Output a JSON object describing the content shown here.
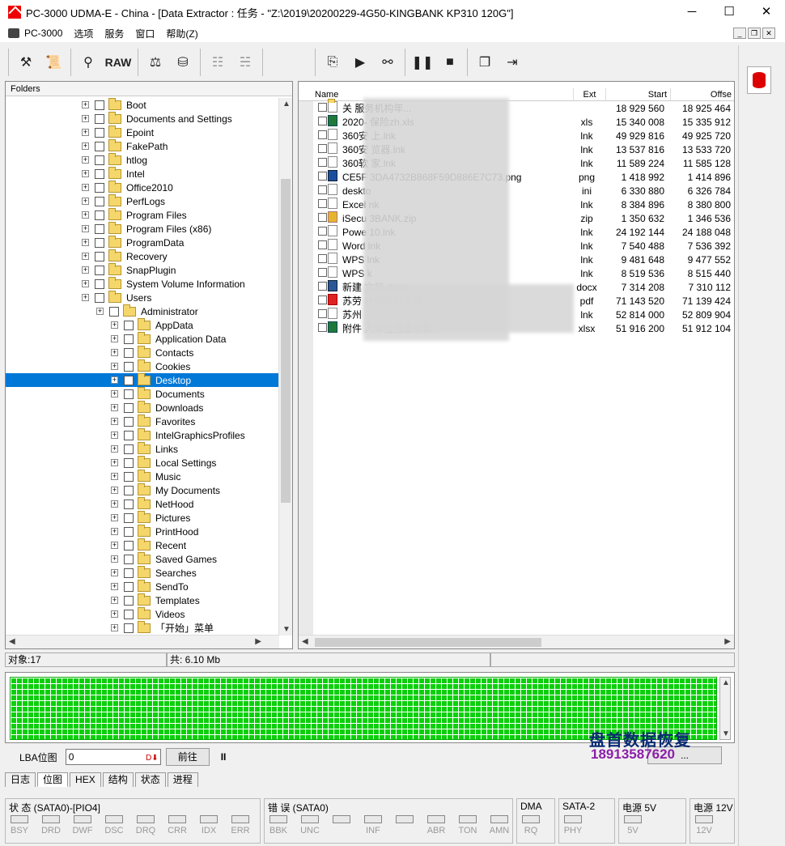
{
  "window": {
    "title": "PC-3000 UDMA-E - China - [Data Extractor : 任务 - \"Z:\\2019\\20200229-4G50-KINGBANK KP310 120G\"]",
    "minimize": "─",
    "maximize": "☐",
    "close": "✕"
  },
  "menu": [
    "PC-3000",
    "选项",
    "服务",
    "窗口",
    "帮助(Z)"
  ],
  "toolbar": {
    "raw": "RAW"
  },
  "folders": {
    "header": "Folders",
    "items": [
      {
        "label": "Boot",
        "level": 0
      },
      {
        "label": "Documents and Settings",
        "level": 0
      },
      {
        "label": "Epoint",
        "level": 0
      },
      {
        "label": "FakePath",
        "level": 0
      },
      {
        "label": "htlog",
        "level": 0
      },
      {
        "label": "Intel",
        "level": 0
      },
      {
        "label": "Office2010",
        "level": 0
      },
      {
        "label": "PerfLogs",
        "level": 0
      },
      {
        "label": "Program Files",
        "level": 0
      },
      {
        "label": "Program Files (x86)",
        "level": 0
      },
      {
        "label": "ProgramData",
        "level": 0
      },
      {
        "label": "Recovery",
        "level": 0
      },
      {
        "label": "SnapPlugin",
        "level": 0
      },
      {
        "label": "System Volume Information",
        "level": 0
      },
      {
        "label": "Users",
        "level": 0
      },
      {
        "label": "Administrator",
        "level": 1
      },
      {
        "label": "AppData",
        "level": 2
      },
      {
        "label": "Application Data",
        "level": 2
      },
      {
        "label": "Contacts",
        "level": 2
      },
      {
        "label": "Cookies",
        "level": 2
      },
      {
        "label": "Desktop",
        "level": 2,
        "selected": true
      },
      {
        "label": "Documents",
        "level": 2
      },
      {
        "label": "Downloads",
        "level": 2
      },
      {
        "label": "Favorites",
        "level": 2
      },
      {
        "label": "IntelGraphicsProfiles",
        "level": 2
      },
      {
        "label": "Links",
        "level": 2
      },
      {
        "label": "Local Settings",
        "level": 2
      },
      {
        "label": "Music",
        "level": 2
      },
      {
        "label": "My Documents",
        "level": 2
      },
      {
        "label": "NetHood",
        "level": 2
      },
      {
        "label": "Pictures",
        "level": 2
      },
      {
        "label": "PrintHood",
        "level": 2
      },
      {
        "label": "Recent",
        "level": 2
      },
      {
        "label": "Saved Games",
        "level": 2
      },
      {
        "label": "Searches",
        "level": 2
      },
      {
        "label": "SendTo",
        "level": 2
      },
      {
        "label": "Templates",
        "level": 2
      },
      {
        "label": "Videos",
        "level": 2
      },
      {
        "label": "「开始」菜单",
        "level": 2
      }
    ]
  },
  "files": {
    "columns": [
      "Name",
      "Ext",
      "Start",
      "Offse"
    ],
    "rows": [
      {
        "name": "关                              服务机构年...",
        "ext": "",
        "start": "18 929 560",
        "off": "18 925 464",
        "icon": "folder"
      },
      {
        "name": "2020-         保险zh.xls",
        "ext": "xls",
        "start": "15 340 008",
        "off": "15 335 912",
        "icon": "xls"
      },
      {
        "name": "360安       上.lnk",
        "ext": "lnk",
        "start": "49 929 816",
        "off": "49 925 720",
        "icon": "lnk"
      },
      {
        "name": "360安       览器.lnk",
        "ext": "lnk",
        "start": "13 537 816",
        "off": "13 533 720",
        "icon": "lnk"
      },
      {
        "name": "360软       家.lnk",
        "ext": "lnk",
        "start": "11 589 224",
        "off": "11 585 128",
        "icon": "lnk"
      },
      {
        "name": "CE5F     3DA4732B868F59D886E7C73.png",
        "ext": "png",
        "start": "1 418 992",
        "off": "1 414 896",
        "icon": "png"
      },
      {
        "name": "deskto",
        "ext": "ini",
        "start": "6 330 880",
        "off": "6 326 784",
        "icon": "lnk"
      },
      {
        "name": "Excel         nk",
        "ext": "lnk",
        "start": "8 384 896",
        "off": "8 380 800",
        "icon": "lnk"
      },
      {
        "name": "iSecu       3BANK.zip",
        "ext": "zip",
        "start": "1 350 632",
        "off": "1 346 536",
        "icon": "zip"
      },
      {
        "name": "Powe       10.lnk",
        "ext": "lnk",
        "start": "24 192 144",
        "off": "24 188 048",
        "icon": "lnk"
      },
      {
        "name": "Word         lnk",
        "ext": "lnk",
        "start": "7 540 488",
        "off": "7 536 392",
        "icon": "lnk"
      },
      {
        "name": "WPS          lnk",
        "ext": "lnk",
        "start": "9 481 648",
        "off": "9 477 552",
        "icon": "lnk"
      },
      {
        "name": "WPS          k",
        "ext": "lnk",
        "start": "8 519 536",
        "off": "8 515 440",
        "icon": "lnk"
      },
      {
        "name": "新建          文档.docx",
        "ext": "docx",
        "start": "7 314 208",
        "off": "7 310 112",
        "icon": "doc"
      },
      {
        "name": "苏劳                          社微信公众号...",
        "ext": "pdf",
        "start": "71 143 520",
        "off": "71 139 424",
        "icon": "pdf"
      },
      {
        "name": "苏州",
        "ext": "lnk",
        "start": "52 814 000",
        "off": "52 809 904",
        "icon": "lnk"
      },
      {
        "name": "附件                          人单位信息采集...",
        "ext": "xlsx",
        "start": "51 916 200",
        "off": "51 912 104",
        "icon": "xls"
      }
    ]
  },
  "status": {
    "objects": "对象:17",
    "total": "共:  6.10 Mb"
  },
  "lba": {
    "label": "LBA位图",
    "value": "0",
    "forward": "前往",
    "pause": "II",
    "right_button": "..."
  },
  "watermark": {
    "line1": "盘首数据恢复",
    "line2": "18913587620"
  },
  "tabs": [
    "日志",
    "位图",
    "HEX",
    "结构",
    "状态",
    "进程"
  ],
  "led_groups": [
    {
      "label": "状 态 (SATA0)-[PIO4]",
      "leds": [
        "BSY",
        "DRD",
        "DWF",
        "DSC",
        "DRQ",
        "CRR",
        "IDX",
        "ERR"
      ]
    },
    {
      "label": "错 误 (SATA0)",
      "leds": [
        "BBK",
        "UNC",
        "",
        "INF",
        "",
        "ABR",
        "TON",
        "AMN"
      ]
    },
    {
      "label": "DMA",
      "leds": [
        "RQ"
      ]
    },
    {
      "label": "SATA-2",
      "leds": [
        "PHY"
      ]
    },
    {
      "label": "电源 5V",
      "leds": [
        "5V"
      ]
    },
    {
      "label": "电源 12V",
      "leds": [
        "12V"
      ]
    }
  ]
}
